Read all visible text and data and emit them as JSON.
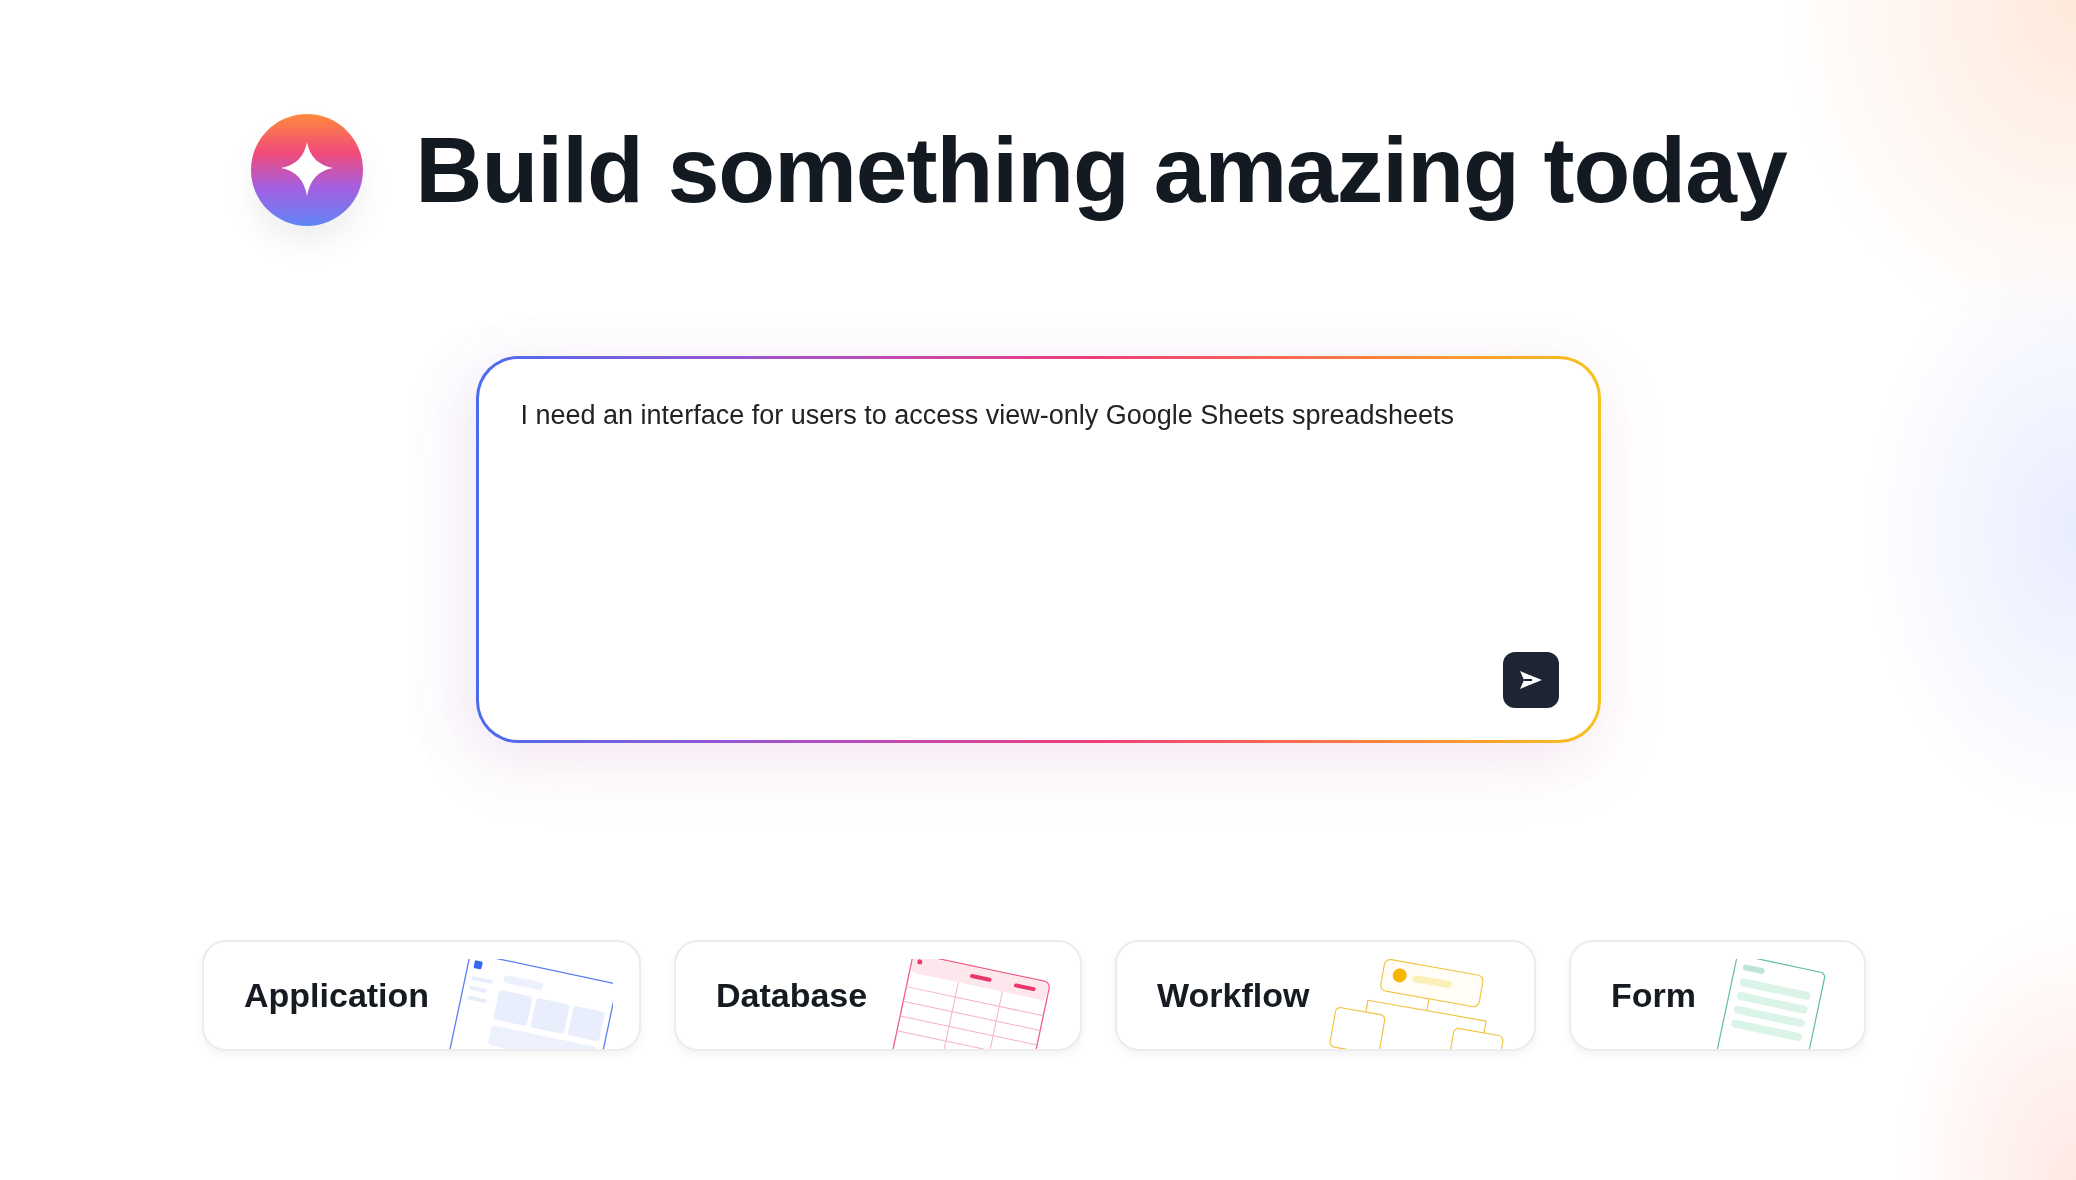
{
  "heading": "Build something amazing today",
  "prompt": {
    "value": "I need an interface for users to access view-only Google Sheets spreadsheets"
  },
  "cards": [
    {
      "label": "Application",
      "kind": "application"
    },
    {
      "label": "Database",
      "kind": "database"
    },
    {
      "label": "Workflow",
      "kind": "workflow"
    },
    {
      "label": "Form",
      "kind": "form"
    }
  ]
}
